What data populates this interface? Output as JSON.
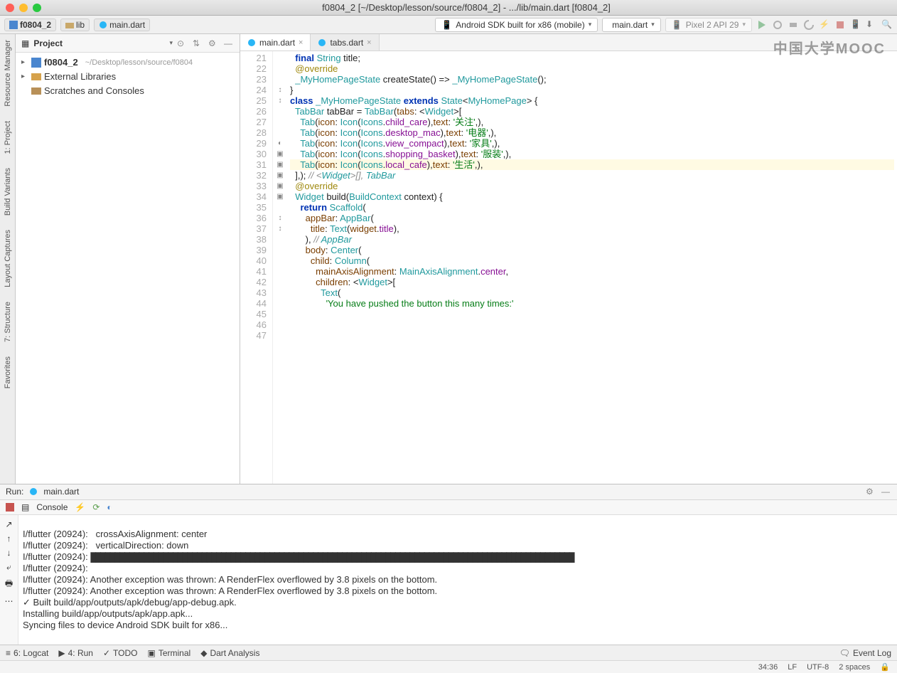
{
  "window": {
    "title": "f0804_2 [~/Desktop/lesson/source/f0804_2] - .../lib/main.dart [f0804_2]"
  },
  "breadcrumbs": {
    "project": "f0804_2",
    "folder": "lib",
    "file": "main.dart"
  },
  "toolbar": {
    "device": "Android SDK built for x86 (mobile)",
    "config": "main.dart",
    "emulator": "Pixel 2 API 29"
  },
  "project_tool": {
    "label": "Project",
    "tree": {
      "root": "f0804_2",
      "root_hint": "~/Desktop/lesson/source/f0804",
      "external": "External Libraries",
      "scratches": "Scratches and Consoles"
    }
  },
  "left_rail": {
    "a": "Resource Manager",
    "b": "1: Project",
    "c": "Build Variants",
    "d": "Layout Captures",
    "e": "7: Structure",
    "f": "Favorites"
  },
  "editor_tabs": {
    "t1": "main.dart",
    "t2": "tabs.dart"
  },
  "code": {
    "lines": {
      "21": "",
      "22": "  final String title;",
      "23": "",
      "24": "  @override",
      "25": "  _MyHomePageState createState() => _MyHomePageState();",
      "26": "}",
      "27": "",
      "28": "class _MyHomePageState extends State<MyHomePage> {",
      "29": "  TabBar tabBar = TabBar(tabs: <Widget>[",
      "30": "    Tab(icon: Icon(Icons.child_care),text: '关注',),",
      "31": "    Tab(icon: Icon(Icons.desktop_mac),text: '电器',),",
      "32": "    Tab(icon: Icon(Icons.view_compact),text: '家具',),",
      "33": "    Tab(icon: Icon(Icons.shopping_basket),text: '服装',),",
      "34": "    Tab(icon: Icon(Icons.local_cafe),text: '生活',),",
      "35": "  ],); // <Widget>[], TabBar",
      "36": "  @override",
      "37": "  Widget build(BuildContext context) {",
      "38": "    return Scaffold(",
      "39": "      appBar: AppBar(",
      "40": "        title: Text(widget.title),",
      "41": "      ), // AppBar",
      "42": "      body: Center(",
      "43": "        child: Column(",
      "44": "          mainAxisAlignment: MainAxisAlignment.center,",
      "45": "          children: <Widget>[",
      "46": "            Text(",
      "47": "              'You have pushed the button this many times:'"
    }
  },
  "run": {
    "label": "Run:",
    "config": "main.dart",
    "console_tab": "Console"
  },
  "console": {
    "l1": "I/flutter (20924):   crossAxisAlignment: center",
    "l2": "I/flutter (20924):   verticalDirection: down",
    "l3p": "I/flutter (20924): ",
    "l4": "I/flutter (20924):",
    "l5": "I/flutter (20924): Another exception was thrown: A RenderFlex overflowed by 3.8 pixels on the bottom.",
    "l6": "I/flutter (20924): Another exception was thrown: A RenderFlex overflowed by 3.8 pixels on the bottom.",
    "l7": "✓ Built build/app/outputs/apk/debug/app-debug.apk.",
    "l8": "Installing build/app/outputs/apk/app.apk...",
    "l9": "Syncing files to device Android SDK built for x86..."
  },
  "bottom": {
    "logcat": "6: Logcat",
    "run": "4: Run",
    "todo": "TODO",
    "terminal": "Terminal",
    "dart": "Dart Analysis",
    "eventlog": "Event Log"
  },
  "status": {
    "pos": "34:36",
    "enc": "LF",
    "charset": "UTF-8",
    "indent": "2 spaces"
  },
  "watermark": "中国大学MOOC"
}
